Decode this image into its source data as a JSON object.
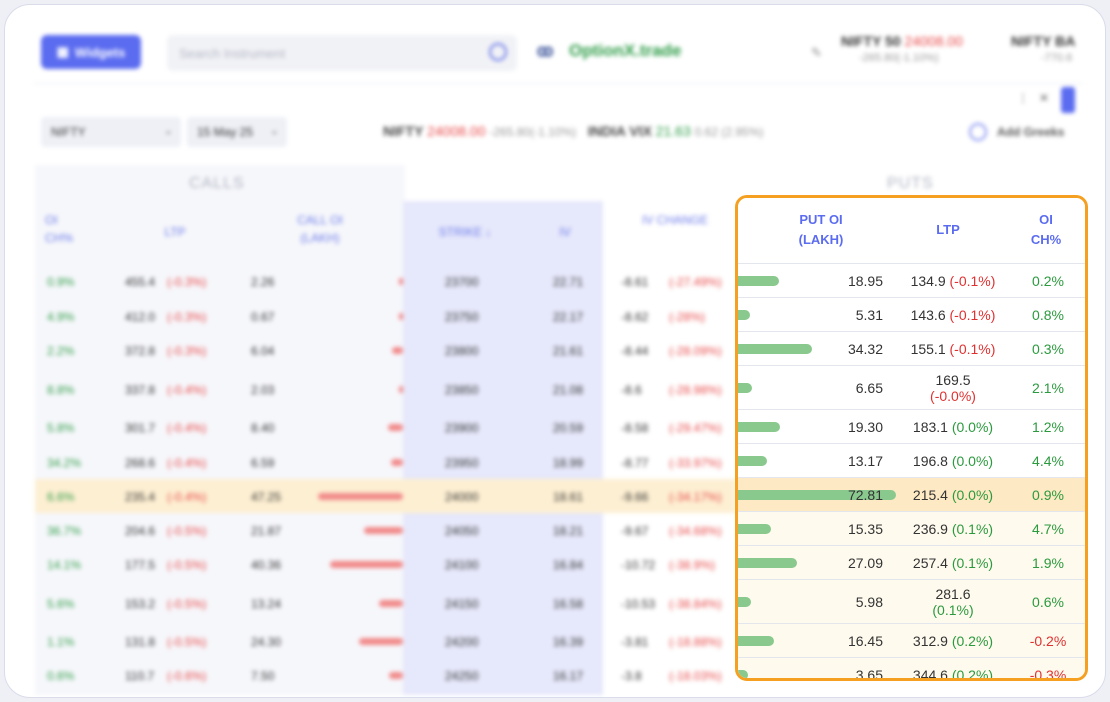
{
  "topbar": {
    "widgets_label": "Widgets",
    "search_placeholder": "Search Instrument",
    "brand": "OptionX.trade",
    "index1": {
      "name": "NIFTY 50",
      "value": "24008.00",
      "change": "-265.80(-1.10%)"
    },
    "index2": {
      "name": "NIFTY BA",
      "change": "-770.6"
    }
  },
  "toolbar": {
    "symbol": "NIFTY",
    "expiry": "15 May 25",
    "ticker_name": "NIFTY",
    "ticker_value": "24008.00",
    "ticker_change": "-265.80(-1.10%)",
    "vix_name": "INDIA VIX",
    "vix_value": "21.63",
    "vix_change": "0.62 (2.95%)",
    "greeks_label": "Add Greeks"
  },
  "chain": {
    "calls_label": "CALLS",
    "puts_label": "PUTS",
    "left_headers": {
      "oi_ch": "OI CH%",
      "ltp": "LTP",
      "call_oi": "CALL OI (LAKH)",
      "strike": "STRIKE ↓",
      "iv": "IV",
      "iv_change": "IV CHANGE"
    },
    "left_rows": [
      {
        "oich": "0.9%",
        "ltp": "455.4",
        "ltpch": "(-0.3%)",
        "oi": "2.26",
        "strike": "23700",
        "iv": "22.71",
        "ivc": "-8.61",
        "ivcp": "(-27.49%)"
      },
      {
        "oich": "4.9%",
        "ltp": "412.0",
        "ltpch": "(-0.3%)",
        "oi": "0.67",
        "strike": "23750",
        "iv": "22.17",
        "ivc": "-8.62",
        "ivcp": "(-28%)"
      },
      {
        "oich": "2.2%",
        "ltp": "372.8",
        "ltpch": "(-0.3%)",
        "oi": "6.04",
        "strike": "23800",
        "iv": "21.61",
        "ivc": "-8.44",
        "ivcp": "(-28.09%)"
      },
      {
        "oich": "8.8%",
        "ltp": "337.8",
        "ltpch": "(-0.4%)",
        "oi": "2.03",
        "strike": "23850",
        "iv": "21.08",
        "ivc": "-8.6",
        "ivcp": "(-28.98%)"
      },
      {
        "oich": "5.8%",
        "ltp": "301.7",
        "ltpch": "(-0.4%)",
        "oi": "8.40",
        "strike": "23900",
        "iv": "20.59",
        "ivc": "-8.58",
        "ivcp": "(-29.47%)"
      },
      {
        "oich": "34.2%",
        "ltp": "268.6",
        "ltpch": "(-0.4%)",
        "oi": "6.59",
        "strike": "23950",
        "iv": "18.99",
        "ivc": "-8.77",
        "ivcp": "(-33.97%)"
      },
      {
        "oich": "6.6%",
        "ltp": "235.4",
        "ltpch": "(-0.4%)",
        "oi": "47.25",
        "strike": "24000",
        "iv": "18.61",
        "ivc": "-9.66",
        "ivcp": "(-34.17%)"
      },
      {
        "oich": "36.7%",
        "ltp": "204.6",
        "ltpch": "(-0.5%)",
        "oi": "21.87",
        "strike": "24050",
        "iv": "18.21",
        "ivc": "-9.67",
        "ivcp": "(-34.68%)"
      },
      {
        "oich": "14.1%",
        "ltp": "177.5",
        "ltpch": "(-0.5%)",
        "oi": "40.36",
        "strike": "24100",
        "iv": "16.84",
        "ivc": "-10.72",
        "ivcp": "(-38.9%)"
      },
      {
        "oich": "5.6%",
        "ltp": "153.2",
        "ltpch": "(-0.5%)",
        "oi": "13.24",
        "strike": "24150",
        "iv": "16.58",
        "ivc": "-10.53",
        "ivcp": "(-38.84%)"
      },
      {
        "oich": "1.1%",
        "ltp": "131.8",
        "ltpch": "(-0.5%)",
        "oi": "24.30",
        "strike": "24200",
        "iv": "16.39",
        "ivc": "-3.81",
        "ivcp": "(-18.88%)"
      },
      {
        "oich": "0.6%",
        "ltp": "110.7",
        "ltpch": "(-0.6%)",
        "oi": "7.50",
        "strike": "24250",
        "iv": "16.17",
        "ivc": "-3.8",
        "ivcp": "(-18.03%)"
      }
    ],
    "put_headers": {
      "put_oi": "PUT OI (LAKH)",
      "ltp": "LTP",
      "oi_ch": "OI CH%"
    },
    "put_rows": [
      {
        "oi": "18.95",
        "oi_value": 18.95,
        "ltp": "134.9",
        "ltpch": "(-0.1%)",
        "oich": "0.2%"
      },
      {
        "oi": "5.31",
        "oi_value": 5.31,
        "ltp": "143.6",
        "ltpch": "(-0.1%)",
        "oich": "0.8%"
      },
      {
        "oi": "34.32",
        "oi_value": 34.32,
        "ltp": "155.1",
        "ltpch": "(-0.1%)",
        "oich": "0.3%"
      },
      {
        "oi": "6.65",
        "oi_value": 6.65,
        "ltp": "169.5",
        "ltpch": "(-0.0%)",
        "oich": "2.1%"
      },
      {
        "oi": "19.30",
        "oi_value": 19.3,
        "ltp": "183.1",
        "ltpch": "(0.0%)",
        "oich": "1.2%"
      },
      {
        "oi": "13.17",
        "oi_value": 13.17,
        "ltp": "196.8",
        "ltpch": "(0.0%)",
        "oich": "4.4%"
      },
      {
        "oi": "72.81",
        "oi_value": 72.81,
        "ltp": "215.4",
        "ltpch": "(0.0%)",
        "oich": "0.9%"
      },
      {
        "oi": "15.35",
        "oi_value": 15.35,
        "ltp": "236.9",
        "ltpch": "(0.1%)",
        "oich": "4.7%"
      },
      {
        "oi": "27.09",
        "oi_value": 27.09,
        "ltp": "257.4",
        "ltpch": "(0.1%)",
        "oich": "1.9%"
      },
      {
        "oi": "5.98",
        "oi_value": 5.98,
        "ltp": "281.6",
        "ltpch": "(0.1%)",
        "oich": "0.6%"
      },
      {
        "oi": "16.45",
        "oi_value": 16.45,
        "ltp": "312.9",
        "ltpch": "(0.2%)",
        "oich": "-0.2%"
      },
      {
        "oi": "3.65",
        "oi_value": 3.65,
        "ltp": "344.6",
        "ltpch": "(0.2%)",
        "oich": "-0.3%"
      }
    ]
  },
  "colors": {
    "accent": "#5b6cf0",
    "highlight_border": "#f5a020",
    "positive": "#2b9a3e",
    "negative": "#e03131",
    "oi_bar": "#8ac98e",
    "atm_row": "#fde9c3"
  },
  "icons": {
    "search": "search-icon",
    "edit": "edit-icon",
    "greeks": "greeks-icon",
    "sort": "sort-down-icon"
  }
}
